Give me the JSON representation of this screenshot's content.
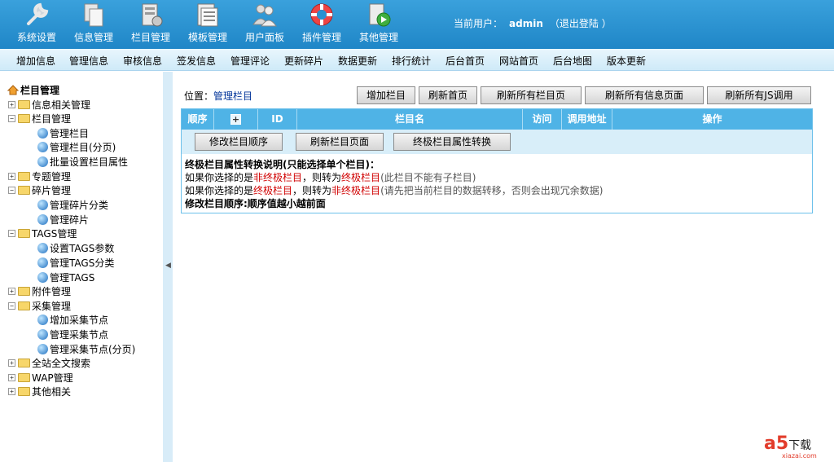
{
  "topnav": [
    {
      "label": "系统设置",
      "icon": "wrench-icon"
    },
    {
      "label": "信息管理",
      "icon": "documents-icon"
    },
    {
      "label": "栏目管理",
      "icon": "column-icon"
    },
    {
      "label": "模板管理",
      "icon": "template-icon"
    },
    {
      "label": "用户面板",
      "icon": "users-icon"
    },
    {
      "label": "插件管理",
      "icon": "lifebuoy-icon"
    },
    {
      "label": "其他管理",
      "icon": "media-icon"
    }
  ],
  "user": {
    "prefix": "当前用户：",
    "name": "admin",
    "logout": "（退出登陆 ）"
  },
  "submenu": [
    "增加信息",
    "管理信息",
    "审核信息",
    "签发信息",
    "管理评论",
    "更新碎片",
    "数据更新",
    "排行统计",
    "后台首页",
    "网站首页",
    "后台地图",
    "版本更新"
  ],
  "tree": {
    "root": "栏目管理",
    "items": [
      {
        "label": "信息相关管理",
        "type": "folder",
        "expanded": false
      },
      {
        "label": "栏目管理",
        "type": "folder",
        "expanded": true
      },
      {
        "label": "管理栏目",
        "type": "leaf"
      },
      {
        "label": "管理栏目(分页)",
        "type": "leaf"
      },
      {
        "label": "批量设置栏目属性",
        "type": "leaf"
      },
      {
        "label": "专题管理",
        "type": "folder",
        "expanded": false
      },
      {
        "label": "碎片管理",
        "type": "folder",
        "expanded": true
      },
      {
        "label": "管理碎片分类",
        "type": "leaf"
      },
      {
        "label": "管理碎片",
        "type": "leaf"
      },
      {
        "label": "TAGS管理",
        "type": "folder",
        "expanded": true
      },
      {
        "label": "设置TAGS参数",
        "type": "leaf"
      },
      {
        "label": "管理TAGS分类",
        "type": "leaf"
      },
      {
        "label": "管理TAGS",
        "type": "leaf"
      },
      {
        "label": "附件管理",
        "type": "folder",
        "expanded": false
      },
      {
        "label": "采集管理",
        "type": "folder",
        "expanded": true
      },
      {
        "label": "增加采集节点",
        "type": "leaf"
      },
      {
        "label": "管理采集节点",
        "type": "leaf"
      },
      {
        "label": "管理采集节点(分页)",
        "type": "leaf"
      },
      {
        "label": "全站全文搜索",
        "type": "folder",
        "expanded": false
      },
      {
        "label": "WAP管理",
        "type": "folder",
        "expanded": false
      },
      {
        "label": "其他相关",
        "type": "folder",
        "expanded": false
      }
    ]
  },
  "location": {
    "prefix": "位置：",
    "link": "管理栏目"
  },
  "toolbar": [
    "增加栏目",
    "刷新首页",
    "刷新所有栏目页",
    "刷新所有信息页面",
    "刷新所有JS调用"
  ],
  "table": {
    "headers": [
      "顺序",
      "+",
      "ID",
      "栏目名",
      "访问",
      "调用地址",
      "操作"
    ],
    "actions": [
      "修改栏目顺序",
      "刷新栏目页面",
      "终极栏目属性转换"
    ]
  },
  "notes": {
    "title": "终极栏目属性转换说明(只能选择单个栏目)：",
    "line1": {
      "a": "如果你选择的是",
      "b": "非终极栏目",
      "c": "，则转为",
      "d": "终极栏目",
      "e": "(此栏目不能有子栏目)"
    },
    "line2": {
      "a": "如果你选择的是",
      "b": "终极栏目",
      "c": "，则转为",
      "d": "非终极栏目",
      "e": "(请先把当前栏目的数据转移，否则会出现冗余数据)"
    },
    "order": "修改栏目顺序:顺序值越小越前面"
  },
  "watermark": {
    "brand": "a5",
    "text": "下载",
    "domain": "xiazai.com"
  },
  "colors": {
    "header": "#2891d1",
    "accent_red": "#d00000",
    "table_header": "#4fb3e6"
  }
}
